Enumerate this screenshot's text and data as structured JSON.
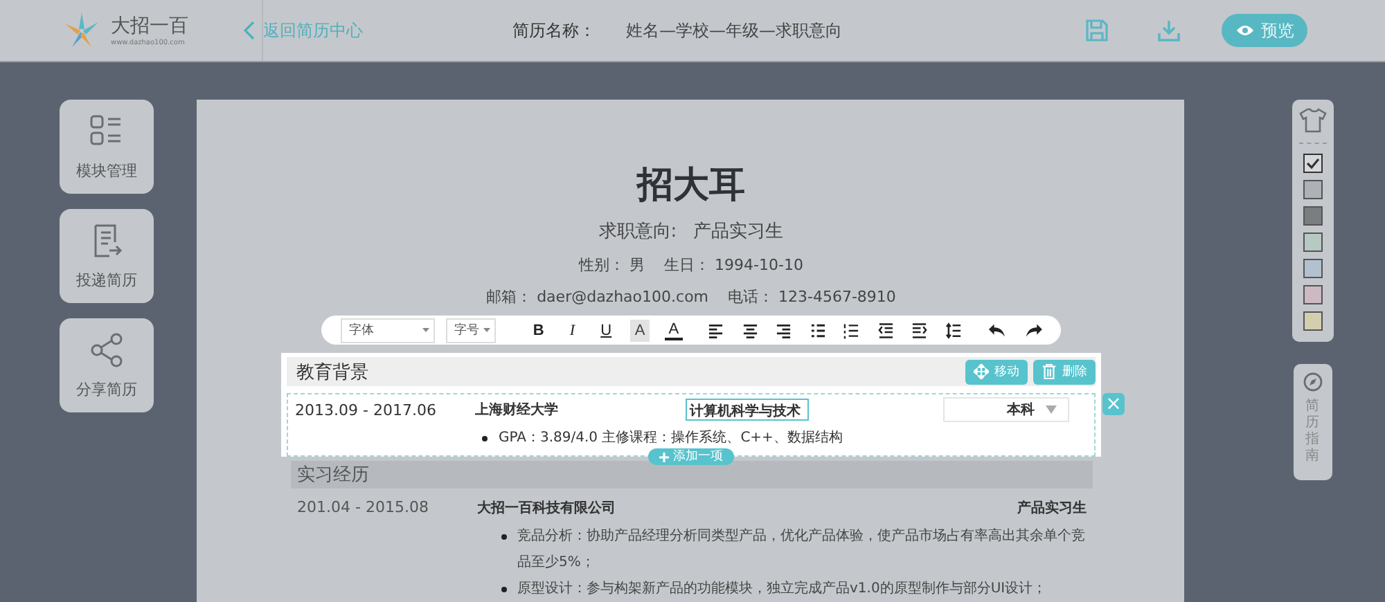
{
  "topbar": {
    "logo_text": "大招一百",
    "logo_sub": "www.dazhao100.com",
    "back_link": "返回简历中心",
    "resume_name_label": "简历名称：",
    "resume_name": "姓名—学校—年级—求职意向",
    "preview_button": "预览"
  },
  "left_tools": [
    {
      "kind": "modules",
      "label": "模块管理"
    },
    {
      "kind": "deliver",
      "label": "投递简历"
    },
    {
      "kind": "share",
      "label": "分享简历"
    }
  ],
  "resume": {
    "name": "招大耳",
    "intent_label": "求职意向:",
    "intent": "产品实习生",
    "info_line_1": "性别： 男    生日： 1994-10-10",
    "info_line_2": "邮箱： daer@dazhao100.com    电话： 123-4567-8910"
  },
  "toolbar": {
    "font_select": "字体",
    "size_select": "字号",
    "glyphs": [
      {
        "kind": "bold",
        "label": "B"
      },
      {
        "kind": "italic",
        "label": "I"
      },
      {
        "kind": "underline",
        "label": "U"
      },
      {
        "kind": "highlight",
        "label": "A"
      },
      {
        "kind": "color",
        "label": "A"
      }
    ]
  },
  "education": {
    "title": "教育背景",
    "move_button": "移动",
    "delete_button": "删除",
    "period": "2013.09 - 2017.06",
    "school": "上海财经大学",
    "major": "计算机科学与技术",
    "degree": "本科",
    "bullets": [
      "GPA：3.89/4.0 主修课程：操作系统、C++、数据结构"
    ],
    "add_button": "添加一项",
    "close_button": "×"
  },
  "internship": {
    "title": "实习经历",
    "period": "201.04 - 2015.08",
    "company": "大招一百科技有限公司",
    "role": "产品实习生",
    "bullets": [
      "竞品分析：协助产品经理分析同类型产品，优化产品体验，使产品市场占有率高出其余单个竞品至少5%；",
      "原型设计：参与构架新产品的功能模块，独立完成产品v1.0的原型制作与部分UI设计；"
    ]
  },
  "themes": [
    {
      "color": "#d6d8da",
      "selected": true
    },
    {
      "color": "#aeb1b5",
      "selected": false
    },
    {
      "color": "#7a7d80",
      "selected": false
    },
    {
      "color": "#b7c9c3",
      "selected": false
    },
    {
      "color": "#b3c1cf",
      "selected": false
    },
    {
      "color": "#cdb9c2",
      "selected": false
    },
    {
      "color": "#d3cfae",
      "selected": false
    }
  ],
  "guide": {
    "label": "简历指南"
  }
}
